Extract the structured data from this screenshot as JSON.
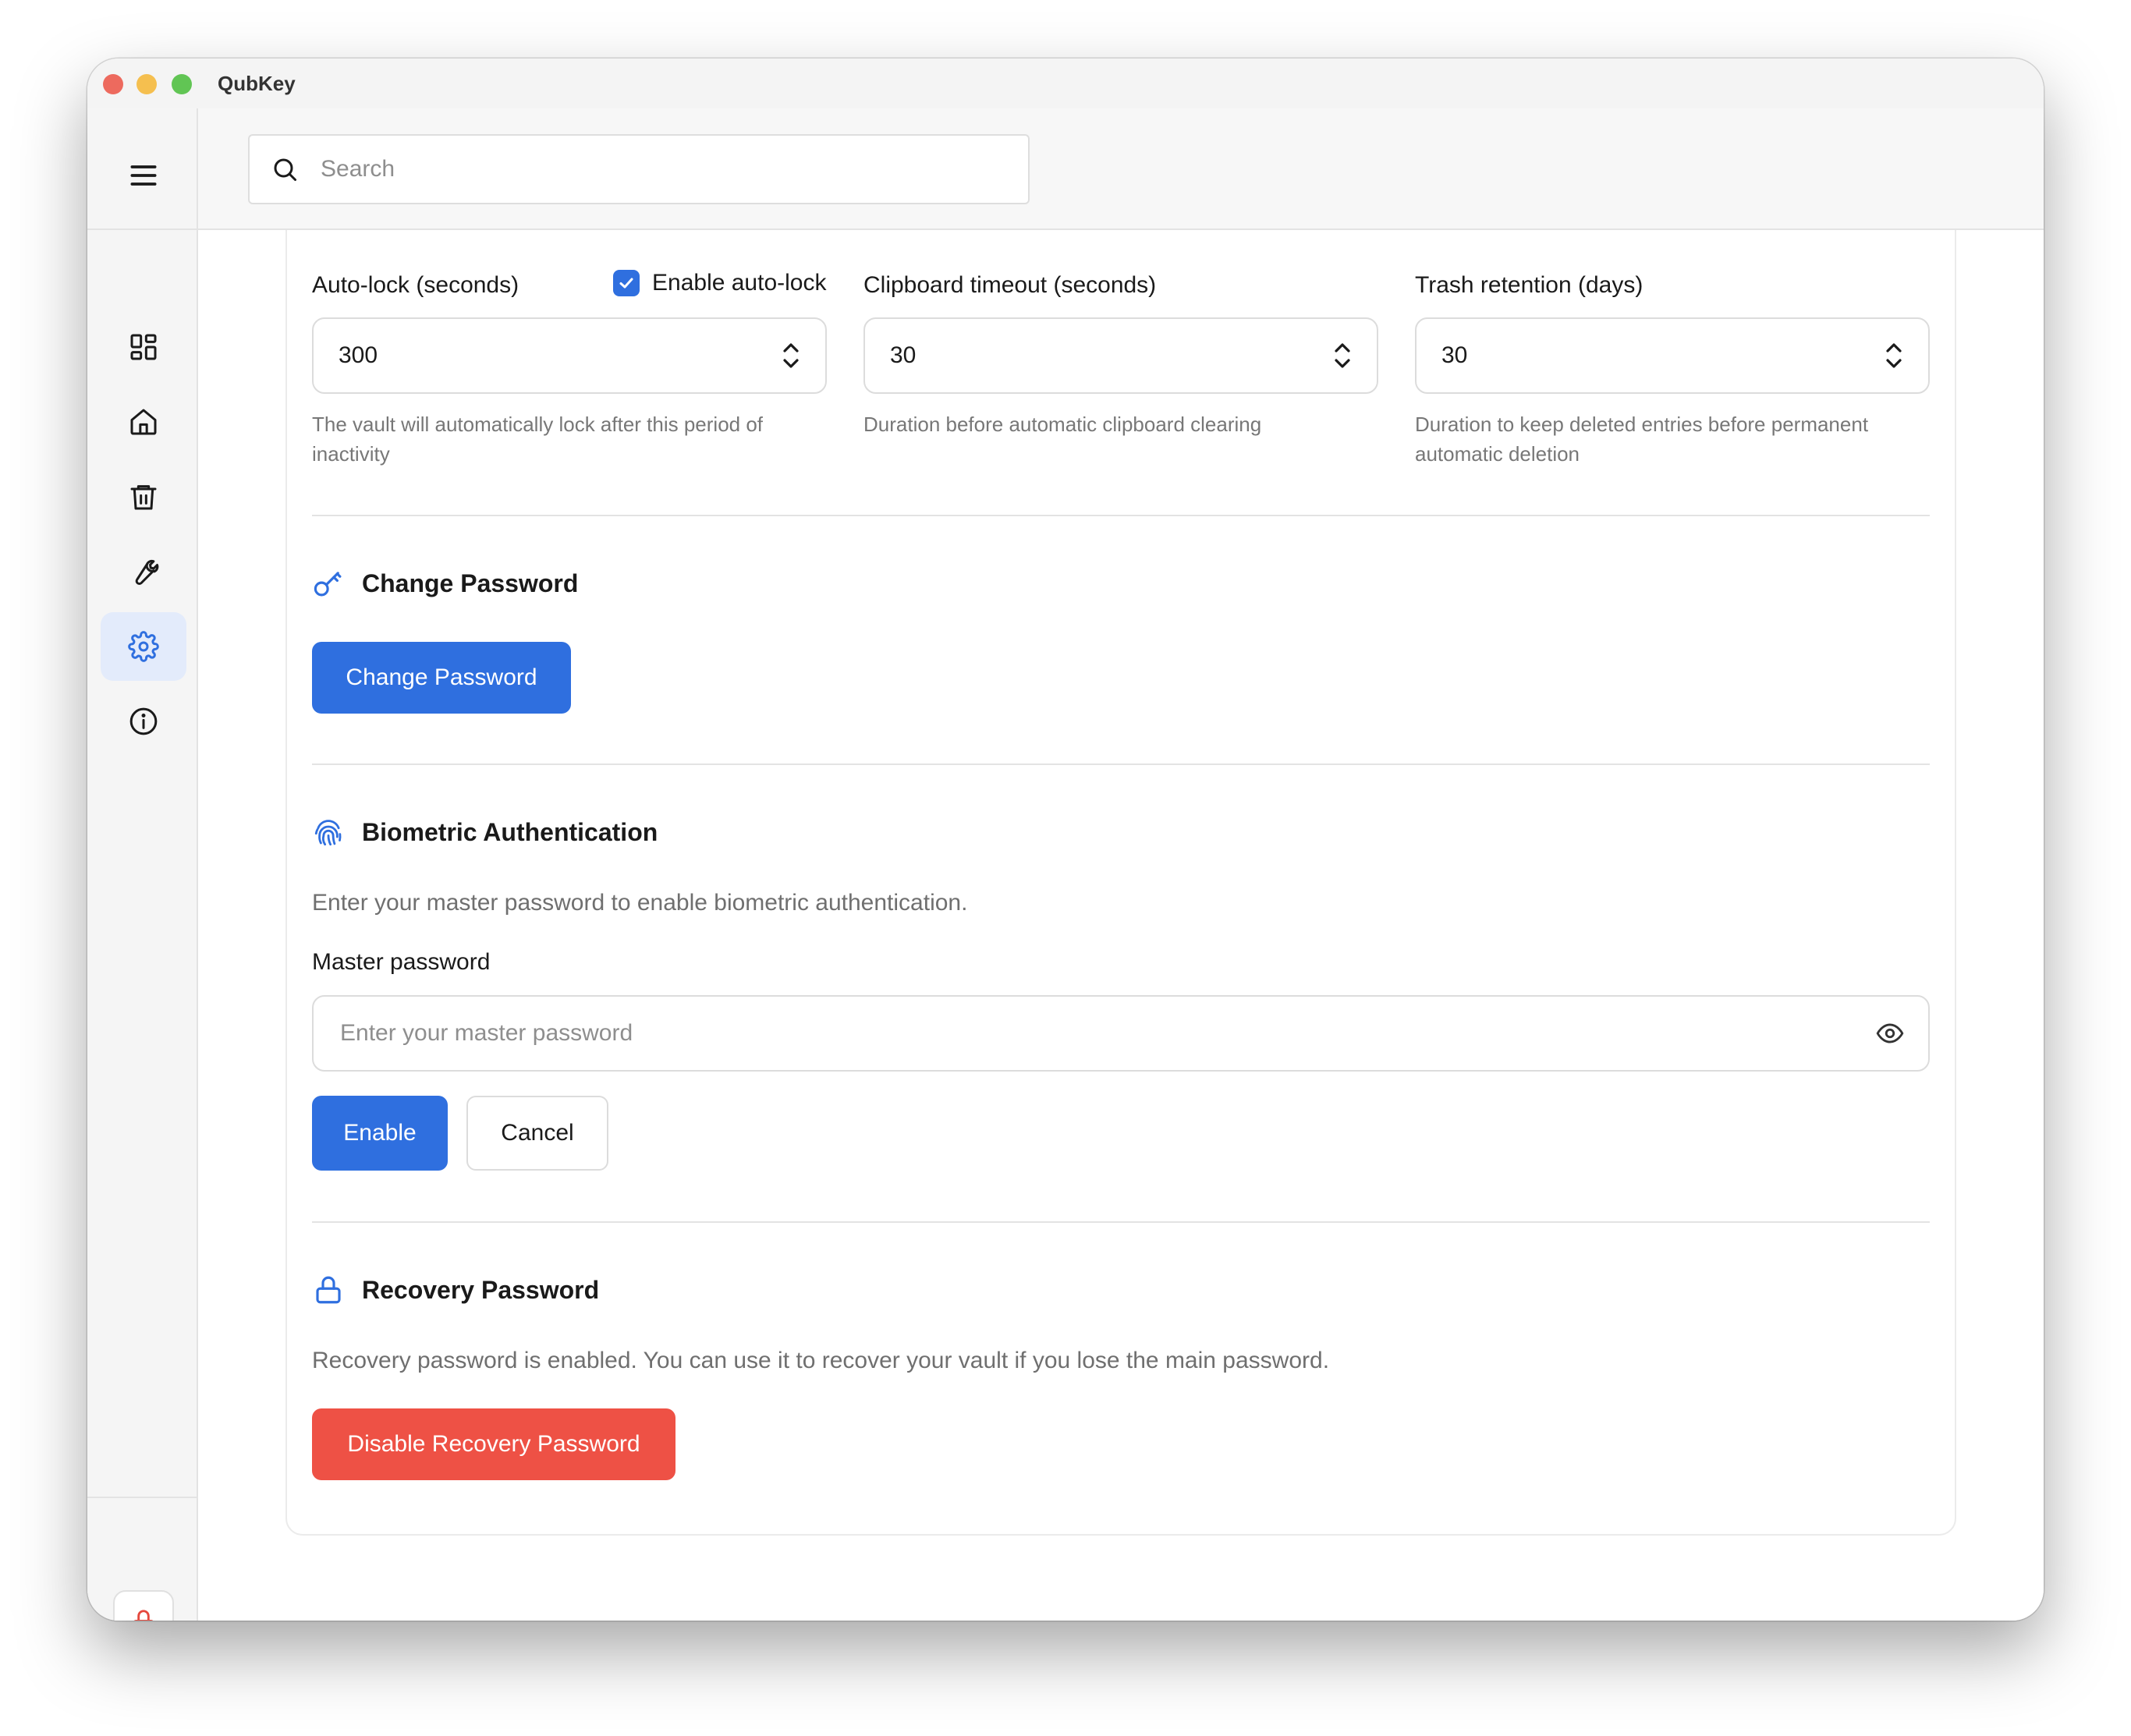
{
  "app": {
    "title": "QubKey"
  },
  "search": {
    "placeholder": "Search"
  },
  "sidebar": {
    "items": [
      {
        "icon": "dashboard-icon",
        "active": false
      },
      {
        "icon": "home-icon",
        "active": false
      },
      {
        "icon": "trash-icon",
        "active": false
      },
      {
        "icon": "wrench-icon",
        "active": false
      },
      {
        "icon": "gear-icon",
        "active": true
      },
      {
        "icon": "info-icon",
        "active": false
      }
    ],
    "lock_icon": "lock-icon"
  },
  "settings": {
    "auto_lock": {
      "label": "Auto-lock (seconds)",
      "checkbox_label": "Enable auto-lock",
      "checked": true,
      "value": "300",
      "hint": "The vault will automatically lock after this period of inactivity"
    },
    "clipboard": {
      "label": "Clipboard timeout (seconds)",
      "value": "30",
      "hint": "Duration before automatic clipboard clearing"
    },
    "trash": {
      "label": "Trash retention (days)",
      "value": "30",
      "hint": "Duration to keep deleted entries before permanent automatic deletion"
    }
  },
  "change_password": {
    "title": "Change Password",
    "button": "Change Password"
  },
  "biometric": {
    "title": "Biometric Authentication",
    "description": "Enter your master password to enable biometric authentication.",
    "field_label": "Master password",
    "placeholder": "Enter your master password",
    "enable_button": "Enable",
    "cancel_button": "Cancel"
  },
  "recovery": {
    "title": "Recovery Password",
    "description": "Recovery password is enabled. You can use it to recover your vault if you lose the main password.",
    "button": "Disable Recovery Password"
  },
  "colors": {
    "accent": "#2f6fdf",
    "danger": "#ee5145",
    "active_nav_bg": "#e3ebfb"
  }
}
